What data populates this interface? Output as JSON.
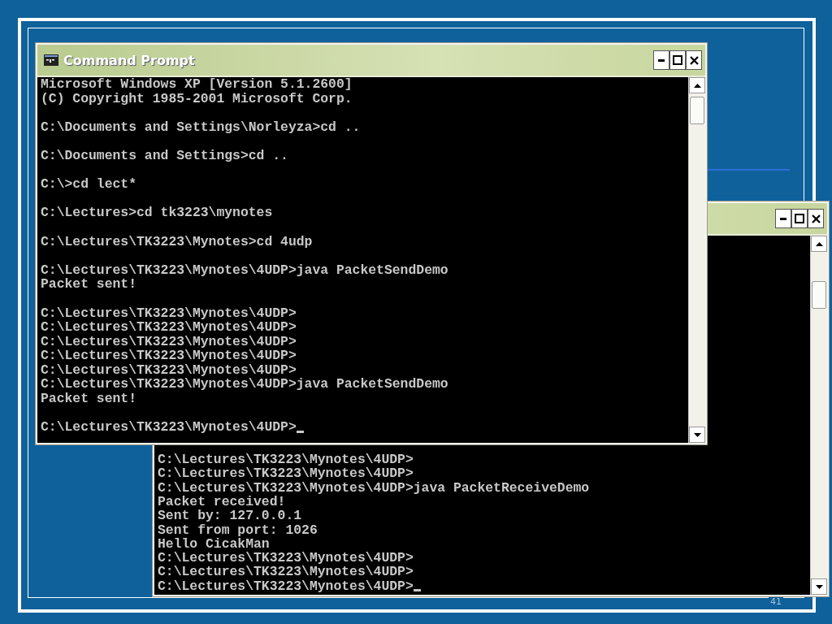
{
  "slide": {
    "page_number": "41"
  },
  "back_window": {
    "cursor": true,
    "groups": [
      [
        "C:\\Lectures\\TK3223\\Mynotes\\4UDP>",
        "C:\\Lectures\\TK3223\\Mynotes\\4UDP>",
        "C:\\Lectures\\TK3223\\Mynotes\\4UDP>java PacketReceiveDemo",
        "Packet received!",
        "Sent by: 127.0.0.1",
        "Sent from port: 1026",
        "Hello CicakMan",
        "C:\\Lectures\\TK3223\\Mynotes\\4UDP>",
        "C:\\Lectures\\TK3223\\Mynotes\\4UDP>",
        "C:\\Lectures\\TK3223\\Mynotes\\4UDP>"
      ]
    ]
  },
  "front_window": {
    "title": "Command Prompt",
    "cursor": true,
    "groups": [
      [
        "Microsoft Windows XP [Version 5.1.2600]",
        "(C) Copyright 1985-2001 Microsoft Corp."
      ],
      [
        "C:\\Documents and Settings\\Norleyza>cd .."
      ],
      [
        "C:\\Documents and Settings>cd .."
      ],
      [
        "C:\\>cd lect*"
      ],
      [
        "C:\\Lectures>cd tk3223\\mynotes"
      ],
      [
        "C:\\Lectures\\TK3223\\Mynotes>cd 4udp"
      ],
      [
        "C:\\Lectures\\TK3223\\Mynotes\\4UDP>java PacketSendDemo",
        "Packet sent!"
      ],
      [
        "C:\\Lectures\\TK3223\\Mynotes\\4UDP>",
        "C:\\Lectures\\TK3223\\Mynotes\\4UDP>",
        "C:\\Lectures\\TK3223\\Mynotes\\4UDP>",
        "C:\\Lectures\\TK3223\\Mynotes\\4UDP>",
        "C:\\Lectures\\TK3223\\Mynotes\\4UDP>",
        "C:\\Lectures\\TK3223\\Mynotes\\4UDP>java PacketSendDemo",
        "Packet sent!"
      ],
      [
        "C:\\Lectures\\TK3223\\Mynotes\\4UDP>"
      ]
    ]
  }
}
